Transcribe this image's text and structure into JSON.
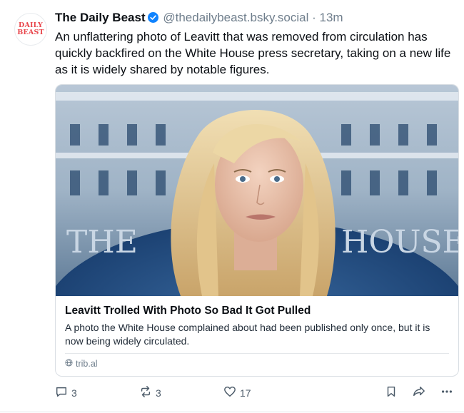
{
  "post": {
    "avatar_logo": "DAILY BEAST",
    "author": "The Daily Beast",
    "handle": "@thedailybeast.bsky.social",
    "separator": " · ",
    "time": "13m",
    "text": "An unflattering photo of Leavitt that was removed from circulation has quickly backfired on the White House press secretary, taking on a new life as it is widely shared by notable figures.",
    "verified_icon": "verified-check-icon"
  },
  "card": {
    "image_text_left": "THE",
    "image_text_right": "HOUSE",
    "title": "Leavitt Trolled With Photo So Bad It Got Pulled",
    "description": "A photo the White House complained about had been published only once, but it is now being widely circulated.",
    "domain": "trib.al"
  },
  "actions": {
    "reply_count": "3",
    "repost_count": "3",
    "like_count": "17"
  },
  "colors": {
    "accent": "#1083fe",
    "muted": "#6f7e8c",
    "logo": "#e8454b"
  }
}
